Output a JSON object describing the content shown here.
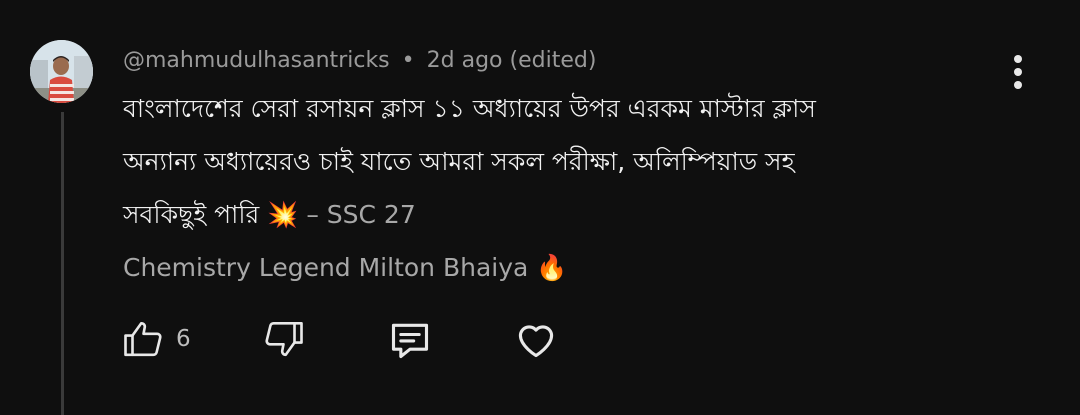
{
  "comment": {
    "author": "@mahmudulhasantricks",
    "separator": "•",
    "timestamp": "2d ago (edited)",
    "lines": [
      "বাংলাদেশের সেরা রসায়ন ক্লাস ১১ অধ্যায়ের উপর এরকম মাস্টার ক্লাস",
      "অন্যান্য অধ্যায়েরও চাই যাতে আমরা সকল পরীক্ষা, অলিম্পিয়াড সহ",
      "সবকিছুই পারি 💥",
      "Chemistry Legend Milton Bhaiya 🔥"
    ],
    "signature": " – SSC 27"
  },
  "actions": {
    "like_count": "6"
  },
  "icons": {
    "like": "thumbs-up-icon",
    "dislike": "thumbs-down-icon",
    "reply": "comment-icon",
    "heart": "heart-icon",
    "menu": "more-vert-icon"
  },
  "colors": {
    "background": "#0f0f0f",
    "text": "#f1f1f1",
    "secondary": "#9a9a9a",
    "icon": "#e8e8e8"
  }
}
